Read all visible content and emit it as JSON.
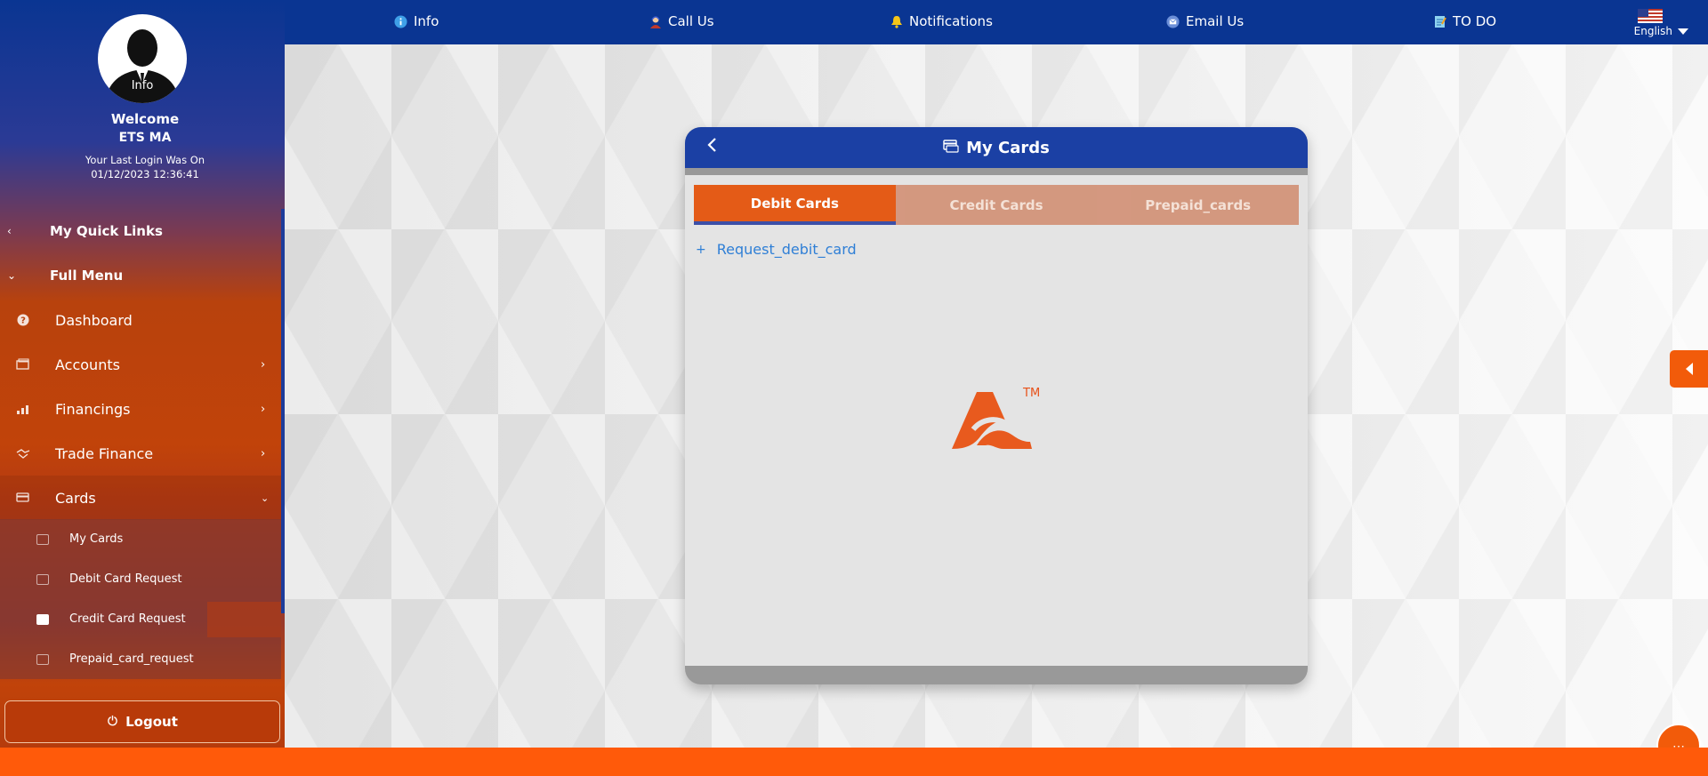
{
  "topnav": {
    "info": "Info",
    "call_us": "Call Us",
    "notifications": "Notifications",
    "email_us": "Email Us",
    "todo": "TO DO",
    "language": "English"
  },
  "profile": {
    "avatar_label": "Info",
    "welcome": "Welcome",
    "username": "ETS MA",
    "last_login_label": "Your Last Login Was On",
    "last_login_value": "01/12/2023 12:36:41"
  },
  "sidebar": {
    "quick_links": "My Quick Links",
    "full_menu": "Full Menu",
    "items": [
      {
        "label": "Dashboard",
        "icon": "help-circle-icon"
      },
      {
        "label": "Accounts",
        "icon": "wallet-icon"
      },
      {
        "label": "Financings",
        "icon": "chart-icon"
      },
      {
        "label": "Trade Finance",
        "icon": "handshake-icon"
      },
      {
        "label": "Cards",
        "icon": "card-icon"
      }
    ],
    "card_sub_items": [
      {
        "label": "My Cards"
      },
      {
        "label": "Debit Card Request"
      },
      {
        "label": "Credit Card Request"
      },
      {
        "label": "Prepaid_card_request"
      }
    ],
    "logout": "Logout"
  },
  "panel": {
    "title": "My Cards",
    "tabs": [
      {
        "label": "Debit Cards",
        "active": true
      },
      {
        "label": "Credit Cards",
        "active": false
      },
      {
        "label": "Prepaid_cards",
        "active": false
      }
    ],
    "request_link": "Request_debit_card",
    "logo_tm": "TM"
  },
  "colors": {
    "primary_blue": "#0a3592",
    "accent_orange": "#e4540d",
    "footer_orange": "#ff5a0a",
    "link_blue": "#2f7fd6"
  }
}
